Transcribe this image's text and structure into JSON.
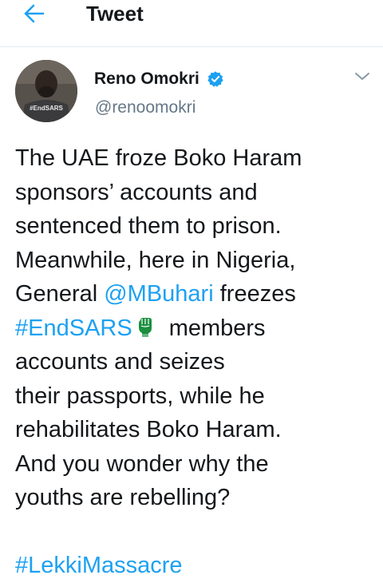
{
  "header": {
    "title": "Tweet",
    "back_icon": "arrow-left-icon",
    "accent_color": "#1da1f2"
  },
  "author": {
    "name": "Reno Omokri",
    "handle": "@renoomokri",
    "verified_icon": "verified-badge-icon",
    "avatar_shirt_text": "#EndSARS"
  },
  "menu": {
    "icon": "chevron-down-icon"
  },
  "tweet": {
    "lines": [
      "The UAE froze Boko Haram",
      "sponsors’ accounts and",
      "sentenced them to prison.",
      "Meanwhile, here in Nigeria,",
      "General ",
      "@MBuhari",
      " freezes",
      "#EndSARS",
      "members",
      "accounts and seizes",
      "their passports, while he",
      "rehabilitates Boko Haram.",
      "And you wonder why the",
      "youths are rebelling?",
      "#LekkiMassacre"
    ],
    "emoji": "raised-fist-emoji"
  },
  "colors": {
    "text": "#14171a",
    "secondary": "#657786",
    "link": "#1da1f2",
    "divider": "#e6ecf0"
  }
}
